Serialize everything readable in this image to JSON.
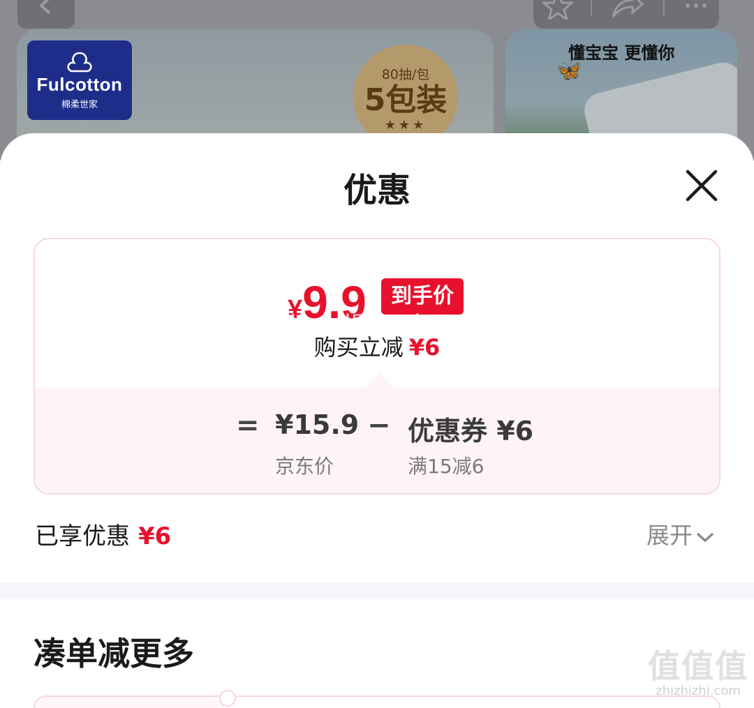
{
  "background": {
    "brand_name": "Fulcotton",
    "brand_subtitle": "棉柔世家",
    "pack_count": "80抽/包",
    "pack_label": "5包装",
    "pack_stars": "★★★",
    "slogan": "懂宝宝 更懂你"
  },
  "sheet": {
    "title": "优惠"
  },
  "price_card": {
    "final_currency": "¥",
    "final_price": "9.9",
    "final_tag": "到手价",
    "watermark": "做个慢星人",
    "instant_label": "购买立减",
    "instant_amount": "¥6",
    "equals": "=",
    "jd_price": "¥15.9",
    "jd_price_label": "京东价",
    "minus": "−",
    "coupon_value": "优惠券 ¥6",
    "coupon_rule": "满15减6"
  },
  "summary": {
    "enjoyed_label": "已享优惠",
    "enjoyed_amount": "¥6",
    "expand_label": "展开"
  },
  "more": {
    "title": "凑单减更多"
  },
  "site_watermark": {
    "logo": "值值值",
    "url": "zhizhizhi.com"
  },
  "colors": {
    "accent_red": "#e8112d",
    "card_border": "#f7d6dc",
    "card_bottom_bg": "#fff4f5"
  }
}
